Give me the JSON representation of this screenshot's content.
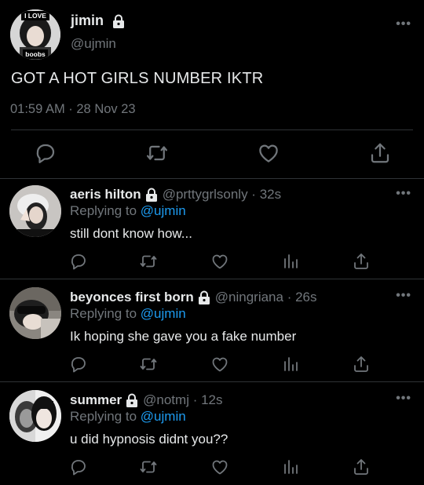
{
  "main_tweet": {
    "avatar_sticker_top": "I LOVE",
    "avatar_sticker_bottom": "boobs",
    "display_name": "jimin",
    "handle": "@ujmin",
    "more": "•••",
    "text": "GOT A HOT GIRLS NUMBER IKTR",
    "timestamp": "01:59 AM · 28 Nov 23"
  },
  "replies": [
    {
      "display_name": "aeris hilton",
      "handle": "@prttygrlsonly · 32s",
      "replying_prefix": "Replying to",
      "replying_to": "@ujmin",
      "text": "still dont know how...",
      "more": "•••"
    },
    {
      "display_name": "beyonces first born",
      "handle": "@ningriana · 26s",
      "replying_prefix": "Replying to",
      "replying_to": "@ujmin",
      "text": "Ik hoping she gave you a fake number",
      "more": "•••"
    },
    {
      "display_name": "summer",
      "handle": "@notmj · 12s",
      "replying_prefix": "Replying to",
      "replying_to": "@ujmin",
      "text": "u did hypnosis didnt you??",
      "more": "•••"
    }
  ],
  "icons": [
    "reply-icon",
    "retweet-icon",
    "like-icon",
    "views-icon",
    "share-icon",
    "lock-icon"
  ],
  "colors": {
    "background": "#000000",
    "primary_text": "#e7e9ea",
    "secondary_text": "#71767b",
    "link": "#1d9bf0",
    "divider": "#2f3336"
  }
}
